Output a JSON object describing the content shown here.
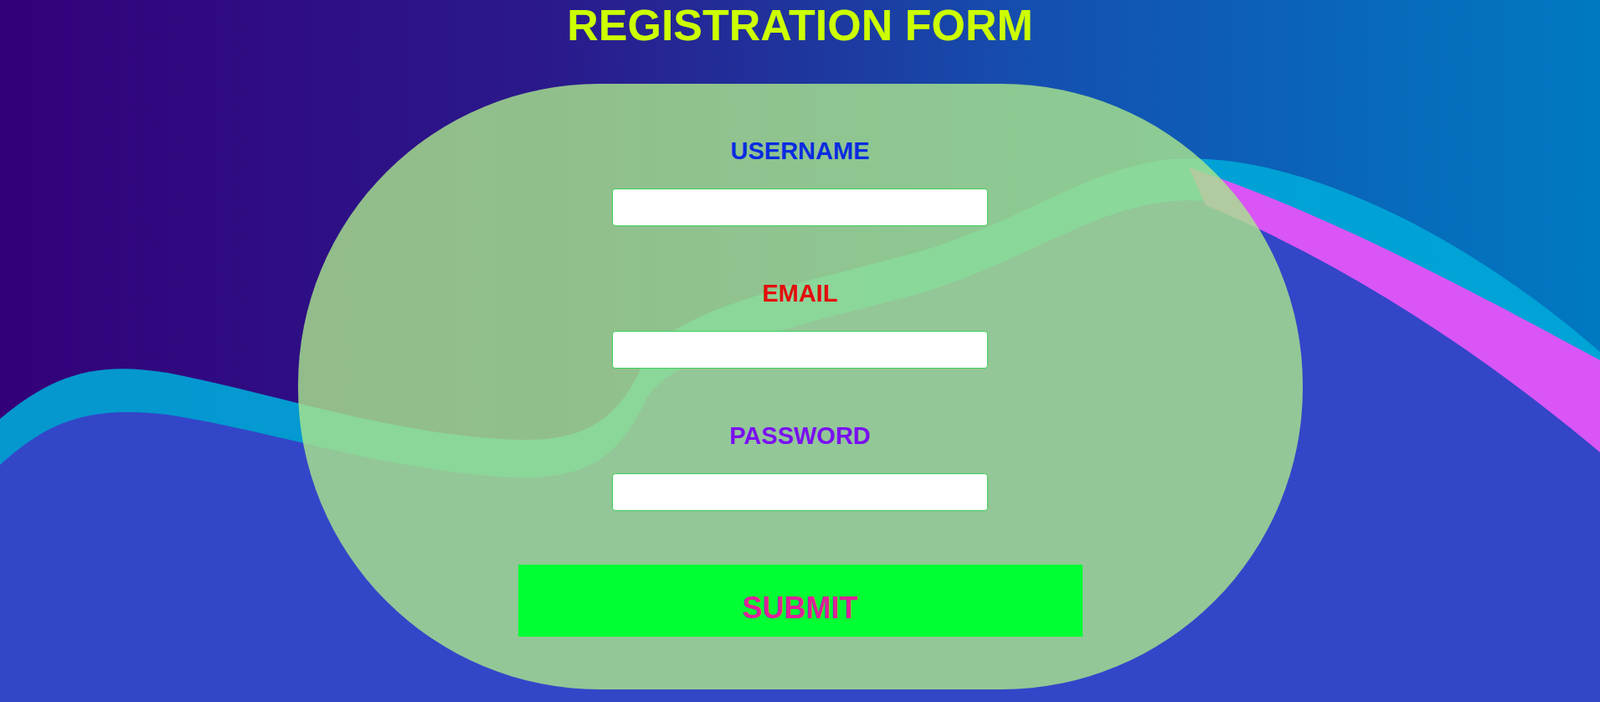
{
  "title": "REGISTRATION FORM",
  "fields": [
    {
      "label": "USERNAME",
      "color": "#0a2be0",
      "type": "text"
    },
    {
      "label": "EMAIL",
      "color": "#e30d0d",
      "type": "email"
    },
    {
      "label": "PASSWORD",
      "color": "#7a0ff0",
      "type": "password"
    }
  ],
  "button": {
    "label": "SUBMIT"
  }
}
